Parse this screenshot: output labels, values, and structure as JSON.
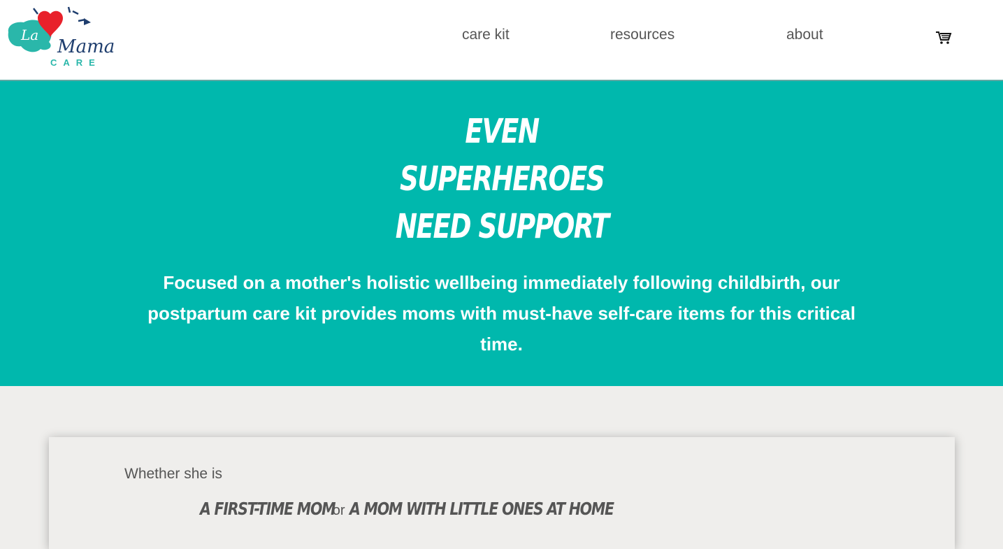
{
  "brand": {
    "logo_script_la": "La",
    "logo_script_mama": "Mama",
    "logo_word": "CARE",
    "colors": {
      "teal": "#00b8ad",
      "navy": "#1f3e6e",
      "heart": "#e8212b"
    }
  },
  "nav": {
    "items": [
      {
        "label": "care kit"
      },
      {
        "label": "resources"
      },
      {
        "label": "about"
      }
    ],
    "cart_icon": "shopping-cart-icon"
  },
  "hero": {
    "title_lines": [
      "EVEN",
      "SUPERHEROES",
      "NEED SUPPORT"
    ],
    "text": "Focused on a mother's holistic wellbeing immediately following childbirth, our postpartum care kit provides moms with must-have self-care items for this critical time."
  },
  "card": {
    "intro": "Whether she is",
    "option_a": "A FIRST-TIME MOM",
    "connector": "or",
    "option_b": "A MOM WITH LITTLE ONES AT HOME"
  }
}
